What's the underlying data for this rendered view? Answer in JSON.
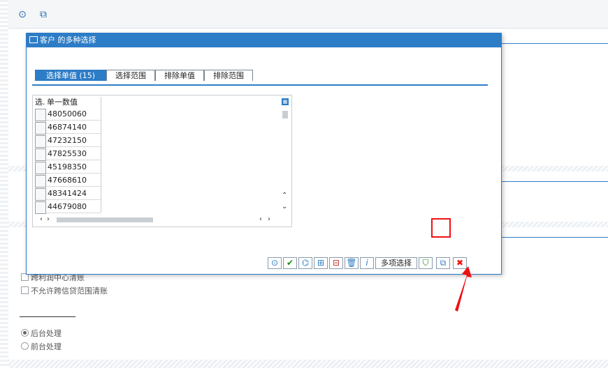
{
  "dialog": {
    "title": "客户 的多种选择",
    "tabs": [
      {
        "label": "选择单值 (15)",
        "active": true
      },
      {
        "label": "选择范围",
        "active": false
      },
      {
        "label": "排除单值",
        "active": false
      },
      {
        "label": "排除范围",
        "active": false
      }
    ],
    "table": {
      "headers": {
        "select": "选.",
        "value": "单一数值"
      },
      "rows": [
        "48050060",
        "46874140",
        "47232150",
        "47825530",
        "45198350",
        "47668610",
        "48341424",
        "44679080"
      ]
    },
    "toolbar": {
      "multi_select_label": "多项选择"
    }
  },
  "background": {
    "options": [
      {
        "label": "跨利润中心清账",
        "checked": true
      },
      {
        "label": "不允许跨信贷范围清账",
        "checked": false
      }
    ],
    "processing": [
      {
        "label": "后台处理",
        "selected": true
      },
      {
        "label": "前台处理",
        "selected": false
      }
    ]
  },
  "colors": {
    "accent": "#2d7cc6",
    "highlight": "#e11111"
  }
}
